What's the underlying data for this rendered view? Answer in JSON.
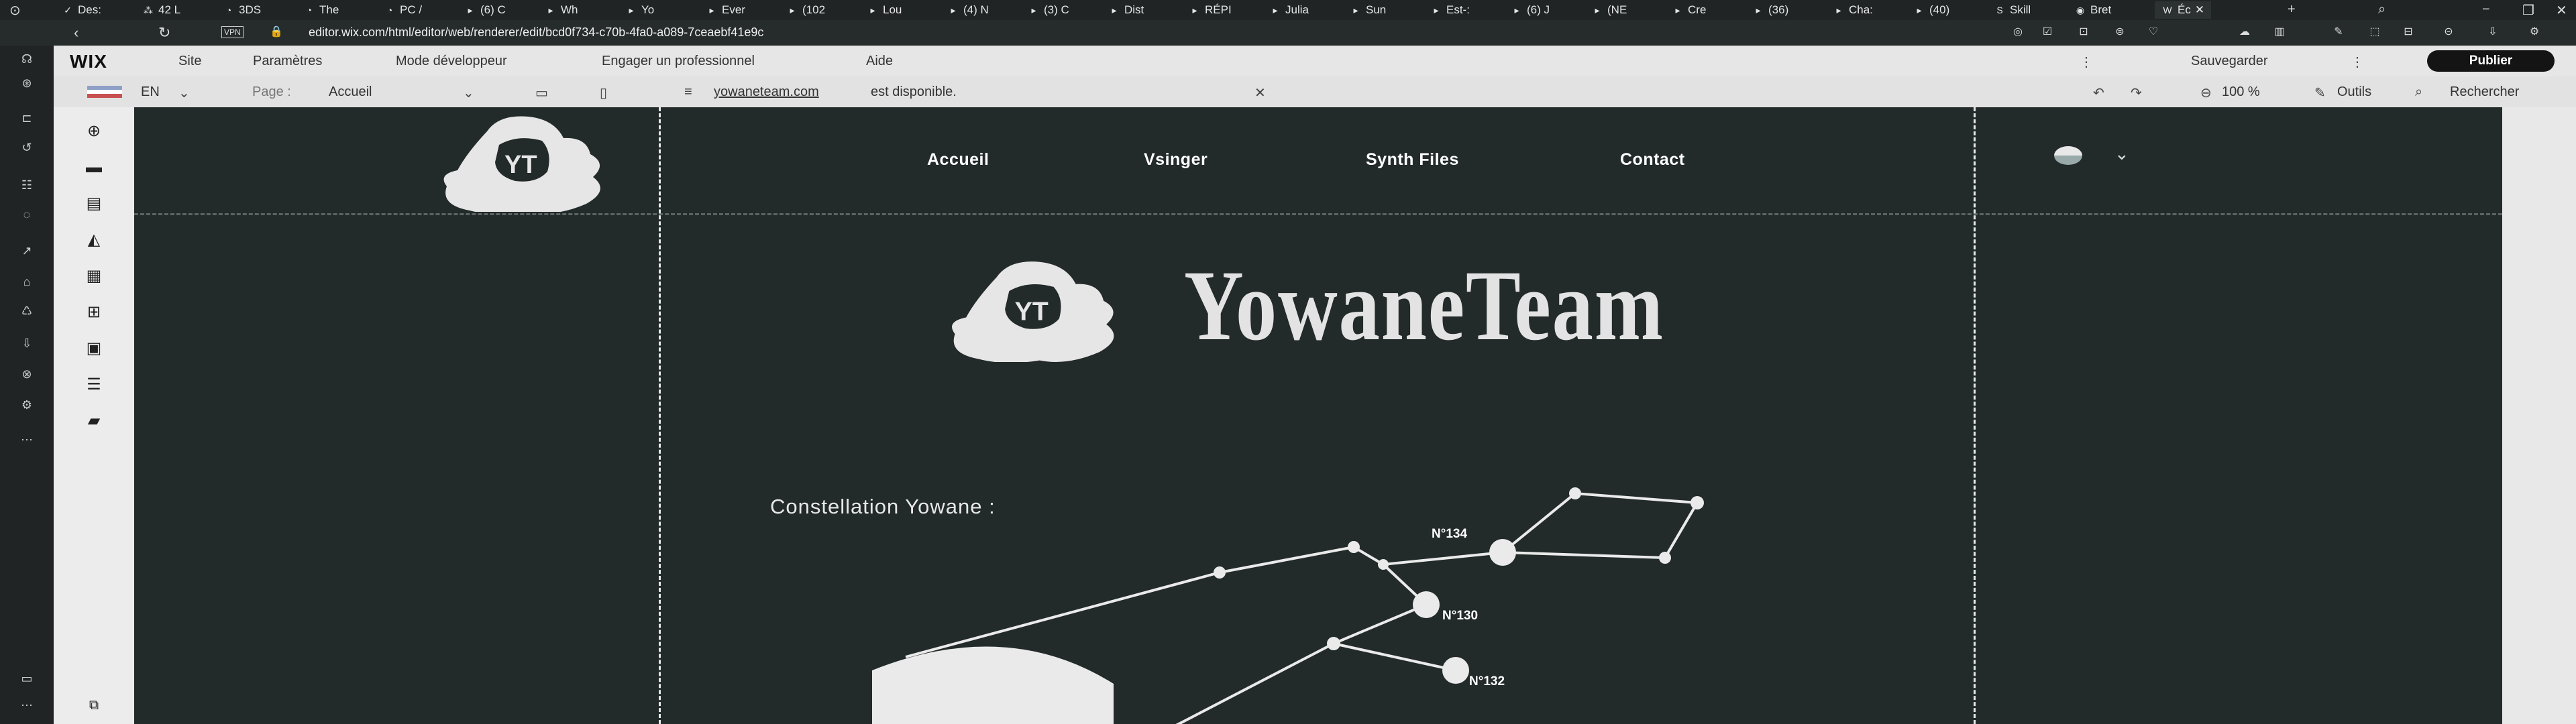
{
  "browser": {
    "tabs": [
      {
        "label": "Des:",
        "icon": "v-icon"
      },
      {
        "label": "42 L",
        "icon": "glyph-icon"
      },
      {
        "label": "3DS",
        "icon": "drive-icon"
      },
      {
        "label": "The",
        "icon": "drive-icon"
      },
      {
        "label": "PC /",
        "icon": "drive-icon"
      },
      {
        "label": "(6) C",
        "icon": "tab-icon"
      },
      {
        "label": "Wh",
        "icon": "tab-icon"
      },
      {
        "label": "Yo",
        "icon": "tab-icon"
      },
      {
        "label": "Ever",
        "icon": "tab-icon"
      },
      {
        "label": "(102",
        "icon": "tab-icon"
      },
      {
        "label": "Lou",
        "icon": "tab-icon"
      },
      {
        "label": "(4) N",
        "icon": "tab-icon"
      },
      {
        "label": "(3) C",
        "icon": "tab-icon"
      },
      {
        "label": "Dist",
        "icon": "tab-icon"
      },
      {
        "label": "RÉPI",
        "icon": "tab-icon"
      },
      {
        "label": "Julia",
        "icon": "tab-icon"
      },
      {
        "label": "Sun",
        "icon": "tab-icon"
      },
      {
        "label": "Est-:",
        "icon": "tab-icon"
      },
      {
        "label": "(6) J",
        "icon": "tab-icon"
      },
      {
        "label": "(NE",
        "icon": "tab-icon"
      },
      {
        "label": "Cre",
        "icon": "tab-icon"
      },
      {
        "label": "(36)",
        "icon": "tab-icon"
      },
      {
        "label": "Cha:",
        "icon": "tab-icon"
      },
      {
        "label": "(40)",
        "icon": "tab-icon"
      },
      {
        "label": "Skill",
        "icon": "skill-icon"
      },
      {
        "label": "Bret",
        "icon": "globe-icon"
      },
      {
        "label": "Éc",
        "icon": "wix-icon"
      }
    ],
    "new_tab": "+",
    "url": "editor.wix.com/html/editor/web/renderer/edit/bcd0f734-c70b-4fa0-a089-7ceaebf41e9c",
    "vpn_label": "VPN"
  },
  "wix": {
    "logo": "WIX",
    "menu": [
      "Site",
      "Paramètres",
      "Mode développeur",
      "Engager un professionnel",
      "Aide"
    ],
    "save_label": "Sauvegarder",
    "publish_label": "Publier",
    "language": "EN",
    "page_prefix": "Page :",
    "page_name": "Accueil",
    "domain_link": "yowaneteam.com",
    "domain_text": "est disponible.",
    "zoom": "100 %",
    "tools_label": "Outils",
    "search_label": "Rechercher"
  },
  "site": {
    "nav": [
      "Accueil",
      "Vsinger",
      "Synth Files",
      "Contact"
    ],
    "brand": "YowaneTeam",
    "logo_text": "YT",
    "constellation_title": "Constellation Yowane :",
    "stars": [
      "N°134",
      "N°130",
      "N°132"
    ]
  },
  "colors": {
    "canvas_bg": "#232a2a",
    "publish_bg": "#141414",
    "text_light": "#e8e8e8"
  }
}
